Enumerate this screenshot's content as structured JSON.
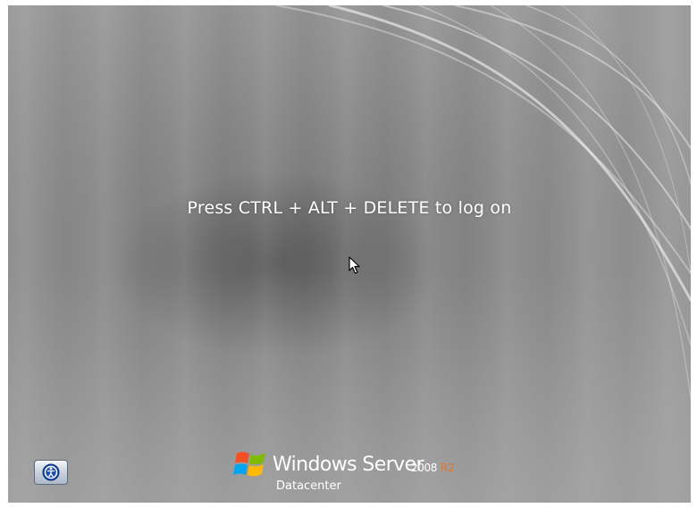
{
  "logon": {
    "prompt": "Press CTRL + ALT + DELETE to log on"
  },
  "ease_of_access": {
    "icon": "ease-of-access-icon"
  },
  "branding": {
    "logo_icon": "windows-flag-icon",
    "product_name": "Windows Server",
    "version": "2008",
    "release": "R2",
    "edition": "Datacenter"
  },
  "colors": {
    "background": "#8c8c8c",
    "text": "#ffffff",
    "release_accent": "#e8732c"
  }
}
